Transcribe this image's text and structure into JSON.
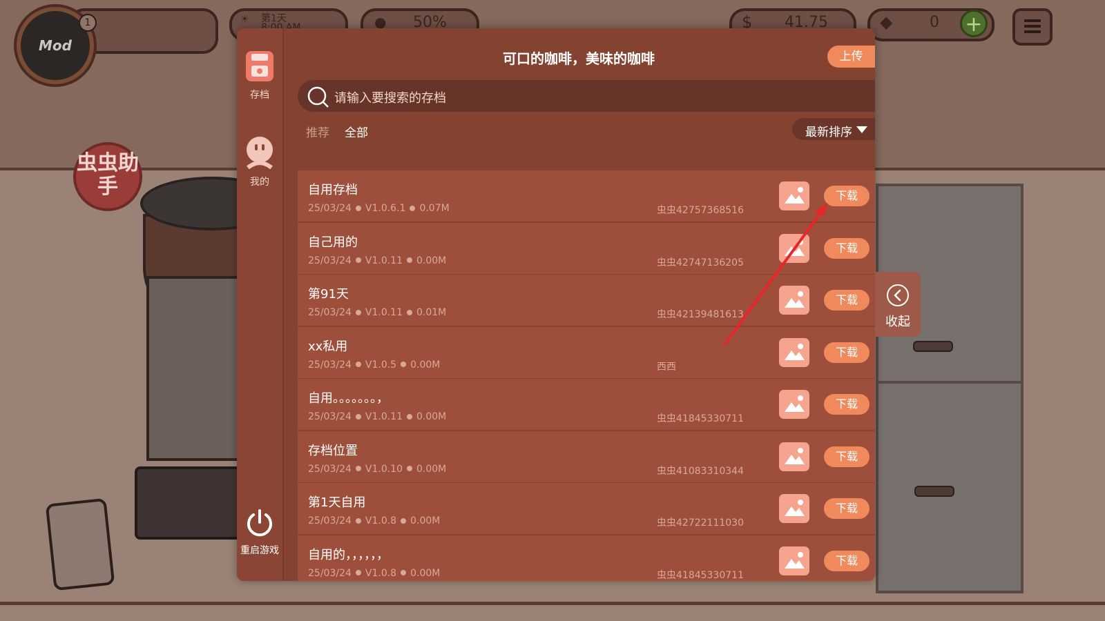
{
  "hud": {
    "avatar_text": "Mod",
    "level": "1",
    "day": "第1天",
    "time": "8:00 AM",
    "mood": "50%",
    "money": "41.75",
    "gems": "0"
  },
  "bg_badge": "虫虫助手",
  "sidebar": {
    "save_label": "存档",
    "mine_label": "我的",
    "restart_label": "重启游戏"
  },
  "header": {
    "title": "可口的咖啡，美味的咖啡",
    "upload_label": "上传"
  },
  "search": {
    "placeholder": "请输入要搜索的存档"
  },
  "tabs": {
    "recommend": "推荐",
    "all": "全部"
  },
  "sort": {
    "label": "最新排序"
  },
  "saves": [
    {
      "title": "自用存档",
      "date": "25/03/24",
      "version": "V1.0.6.1",
      "size": "0.07M",
      "author": "虫虫42757368516",
      "download": "下载"
    },
    {
      "title": "自己用的",
      "date": "25/03/24",
      "version": "V1.0.11",
      "size": "0.00M",
      "author": "虫虫42747136205",
      "download": "下载"
    },
    {
      "title": "第91天",
      "date": "25/03/24",
      "version": "V1.0.11",
      "size": "0.01M",
      "author": "虫虫42139481613",
      "download": "下载"
    },
    {
      "title": "xx私用",
      "date": "25/03/24",
      "version": "V1.0.5",
      "size": "0.00M",
      "author": "西西",
      "download": "下载"
    },
    {
      "title": "自用。。。。。。。，",
      "date": "25/03/24",
      "version": "V1.0.11",
      "size": "0.00M",
      "author": "虫虫41845330711",
      "download": "下载"
    },
    {
      "title": "存档位置",
      "date": "25/03/24",
      "version": "V1.0.10",
      "size": "0.00M",
      "author": "虫虫41083310344",
      "download": "下载"
    },
    {
      "title": "第1天自用",
      "date": "25/03/24",
      "version": "V1.0.8",
      "size": "0.00M",
      "author": "虫虫42722111030",
      "download": "下载"
    },
    {
      "title": "自用的，，，，，，",
      "date": "25/03/24",
      "version": "V1.0.8",
      "size": "0.00M",
      "author": "虫虫41845330711",
      "download": "下载"
    }
  ],
  "collapse": {
    "label": "收起"
  },
  "colors": {
    "accent": "#f08a5d",
    "modal_bg": "#844231",
    "row_bg": "#9e4f3c",
    "annotation_arrow": "#e8262a"
  }
}
